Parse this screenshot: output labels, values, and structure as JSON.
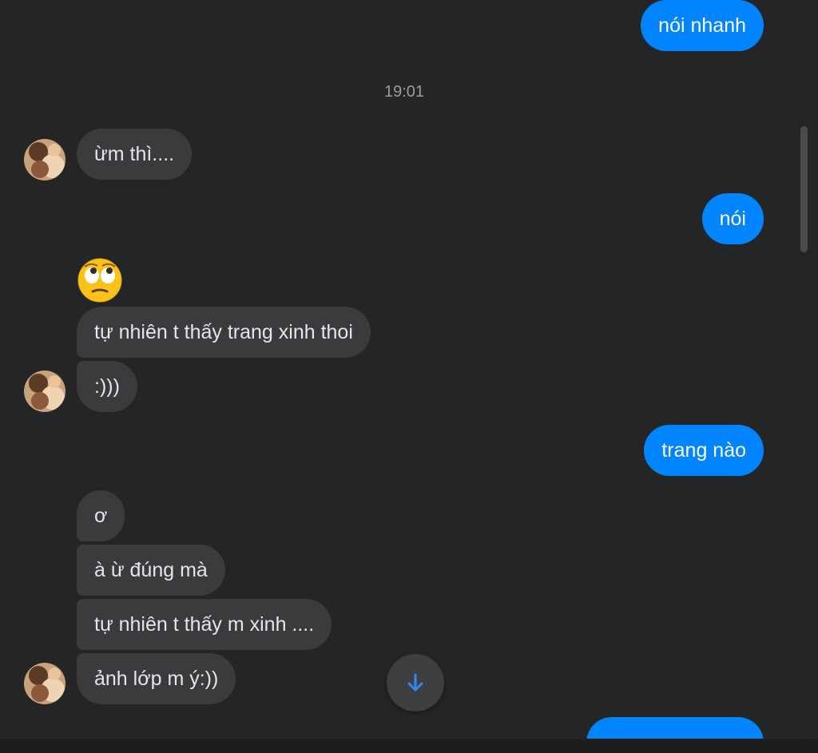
{
  "conversation": {
    "timestamp": "19:01",
    "messages": [
      {
        "text": "nói nhanh"
      },
      {
        "text": "ừm thì...."
      },
      {
        "text": "nói"
      },
      {
        "emoji": "face-with-rolling-eyes"
      },
      {
        "text": "tự nhiên t thấy trang xinh thoi"
      },
      {
        "text": ":)))"
      },
      {
        "text": "trang nào"
      },
      {
        "text": "ơ"
      },
      {
        "text": "à ừ đúng mà"
      },
      {
        "text": "tự nhiên t thấy m xinh ...."
      },
      {
        "text": "ảnh lớp m ý:))"
      }
    ]
  },
  "colors": {
    "background": "#242526",
    "incoming_bubble": "#3a3b3c",
    "outgoing_bubble": "#0084ff",
    "scroll_arrow": "#2d88ff"
  },
  "icons": {
    "scroll_button": "arrow-down-icon",
    "avatar": "contact-avatar"
  }
}
